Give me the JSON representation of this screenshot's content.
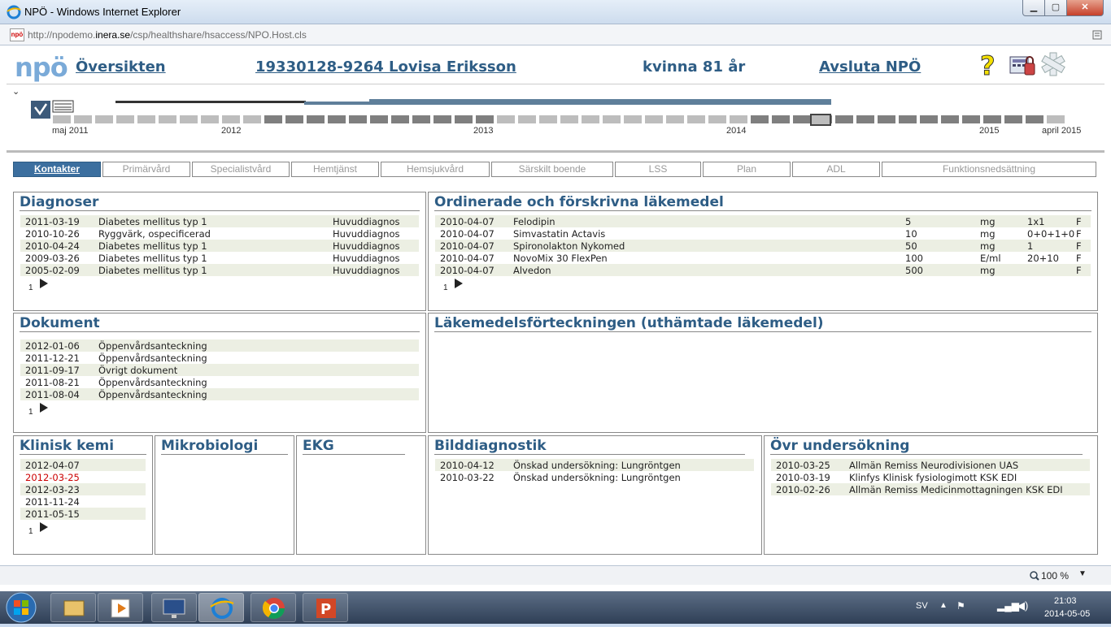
{
  "browser": {
    "title": "NPÖ - Windows Internet Explorer",
    "url_prefix": "http://npodemo.",
    "url_domain": "inera.se",
    "url_suffix": "/csp/healthshare/hsaccess/NPO.Host.cls",
    "zoom": "100 %"
  },
  "header": {
    "logo": "npö",
    "overview": "Översikten",
    "patient": "19330128-9264 Lovisa Eriksson",
    "gender_age": "kvinna 81 år",
    "logout": "Avsluta NPÖ"
  },
  "timeline": {
    "labels": [
      "maj 2011",
      "2012",
      "2013",
      "2014",
      "2015",
      "april 2015"
    ]
  },
  "tabs": [
    "Kontakter",
    "Primärvård",
    "Specialistvård",
    "Hemtjänst",
    "Hemsjukvård",
    "Särskilt boende",
    "LSS",
    "Plan",
    "ADL",
    "Funktionsnedsättning"
  ],
  "diagnoser": {
    "title": "Diagnoser",
    "rows": [
      {
        "date": "2011-03-19",
        "name": "Diabetes mellitus typ 1",
        "type": "Huvuddiagnos"
      },
      {
        "date": "2010-10-26",
        "name": "Ryggvärk, ospecificerad",
        "type": "Huvuddiagnos"
      },
      {
        "date": "2010-04-24",
        "name": "Diabetes mellitus typ 1",
        "type": "Huvuddiagnos"
      },
      {
        "date": "2009-03-26",
        "name": "Diabetes mellitus typ 1",
        "type": "Huvuddiagnos"
      },
      {
        "date": "2005-02-09",
        "name": "Diabetes mellitus typ 1",
        "type": "Huvuddiagnos"
      }
    ],
    "page": "1"
  },
  "lakemedel": {
    "title": "Ordinerade och förskrivna läkemedel",
    "rows": [
      {
        "date": "2010-04-07",
        "name": "Felodipin",
        "dose": "5",
        "unit": "mg",
        "freq": "1x1",
        "flag": "F"
      },
      {
        "date": "2010-04-07",
        "name": "Simvastatin Actavis",
        "dose": "10",
        "unit": "mg",
        "freq": "0+0+1+0",
        "flag": "F"
      },
      {
        "date": "2010-04-07",
        "name": "Spironolakton Nykomed",
        "dose": "50",
        "unit": "mg",
        "freq": "1",
        "flag": "F"
      },
      {
        "date": "2010-04-07",
        "name": "NovoMix 30 FlexPen",
        "dose": "100",
        "unit": "E/ml",
        "freq": "20+10",
        "flag": "F"
      },
      {
        "date": "2010-04-07",
        "name": "Alvedon",
        "dose": "500",
        "unit": "mg",
        "freq": "",
        "flag": "F"
      }
    ],
    "page": "1"
  },
  "dokument": {
    "title": "Dokument",
    "rows": [
      {
        "date": "2012-01-06",
        "name": "Öppenvårdsanteckning"
      },
      {
        "date": "2011-12-21",
        "name": "Öppenvårdsanteckning"
      },
      {
        "date": "2011-09-17",
        "name": "Övrigt dokument"
      },
      {
        "date": "2011-08-21",
        "name": "Öppenvårdsanteckning"
      },
      {
        "date": "2011-08-04",
        "name": "Öppenvårdsanteckning"
      }
    ],
    "page": "1"
  },
  "forteckning": {
    "title": "Läkemedelsförteckningen (uthämtade läkemedel)"
  },
  "kemi": {
    "title": "Klinisk kemi",
    "rows": [
      "2012-04-07",
      "2012-03-25",
      "2012-03-23",
      "2011-11-24",
      "2011-05-15"
    ],
    "highlight_color": "#cc0000",
    "page": "1"
  },
  "mikro": {
    "title": "Mikrobiologi"
  },
  "ekg": {
    "title": "EKG"
  },
  "bild": {
    "title": "Bilddiagnostik",
    "rows": [
      {
        "date": "2010-04-12",
        "name": "Önskad undersökning: Lungröntgen"
      },
      {
        "date": "2010-03-22",
        "name": "Önskad undersökning: Lungröntgen"
      }
    ]
  },
  "ovr": {
    "title": "Övr undersökning",
    "rows": [
      {
        "date": "2010-03-25",
        "name": "Allmän Remiss Neurodivisionen UAS"
      },
      {
        "date": "2010-03-19",
        "name": "Klinfys Klinisk fysiologimott KSK EDI"
      },
      {
        "date": "2010-02-26",
        "name": "Allmän Remiss Medicinmottagningen KSK EDI"
      }
    ]
  },
  "taskbar": {
    "lang": "SV",
    "time": "21:03",
    "date": "2014-05-05"
  }
}
